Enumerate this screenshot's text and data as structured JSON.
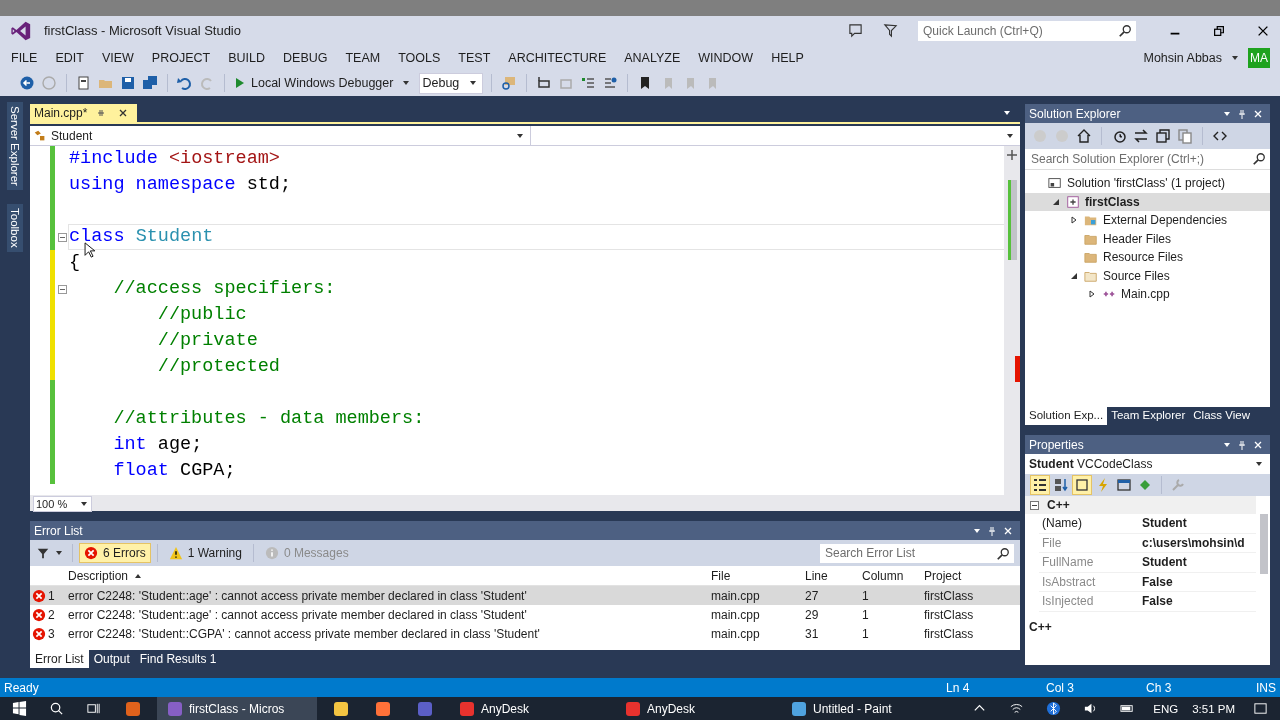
{
  "window": {
    "title": "firstClass - Microsoft Visual Studio",
    "quick_launch": {
      "placeholder": "Quick Launch (Ctrl+Q)"
    },
    "user": "Mohsin Abbas",
    "avatar": "MA"
  },
  "menu": [
    "FILE",
    "EDIT",
    "VIEW",
    "PROJECT",
    "BUILD",
    "DEBUG",
    "TEAM",
    "TOOLS",
    "TEST",
    "ARCHITECTURE",
    "ANALYZE",
    "WINDOW",
    "HELP"
  ],
  "toolbar": {
    "debugger": "Local Windows Debugger",
    "configuration": "Debug"
  },
  "side_tabs": [
    "Server Explorer",
    "Toolbox"
  ],
  "editor": {
    "tab": {
      "label": "Main.cpp*"
    },
    "scope": "Student",
    "zoom": "100 %",
    "lines": [
      {
        "modified": false,
        "tokens": [
          {
            "kind": "keyword",
            "text": "#include "
          },
          {
            "kind": "string",
            "text": "<iostream>"
          }
        ]
      },
      {
        "modified": false,
        "tokens": [
          {
            "kind": "keyword",
            "text": "using namespace "
          },
          {
            "kind": "plain",
            "text": "std;"
          }
        ]
      },
      {
        "modified": false
      },
      {
        "modified": false,
        "current": true,
        "foldable": true,
        "tokens": [
          {
            "kind": "keyword",
            "text": "class "
          },
          {
            "kind": "type",
            "text": "Student"
          }
        ]
      },
      {
        "modified": true,
        "tokens": [
          {
            "kind": "plain",
            "text": "{"
          }
        ]
      },
      {
        "modified": true,
        "foldable": true,
        "tokens": [
          {
            "kind": "comment",
            "text": "    //access specifiers:"
          }
        ]
      },
      {
        "modified": true,
        "tokens": [
          {
            "kind": "comment",
            "text": "        //public"
          }
        ]
      },
      {
        "modified": true,
        "tokens": [
          {
            "kind": "comment",
            "text": "        //private"
          }
        ]
      },
      {
        "modified": true,
        "tokens": [
          {
            "kind": "comment",
            "text": "        //protected"
          }
        ]
      },
      {
        "modified": false
      },
      {
        "modified": false,
        "tokens": [
          {
            "kind": "comment",
            "text": "    //attributes - data members:"
          }
        ]
      },
      {
        "modified": false,
        "tokens": [
          {
            "kind": "keyword",
            "text": "    int "
          },
          {
            "kind": "plain",
            "text": "age;"
          }
        ]
      },
      {
        "modified": false,
        "tokens": [
          {
            "kind": "keyword",
            "text": "    float "
          },
          {
            "kind": "plain",
            "text": "CGPA;"
          }
        ]
      }
    ]
  },
  "error_list": {
    "title": "Error List",
    "filters": [
      {
        "label": "6 Errors",
        "kind": "error",
        "selected": true
      },
      {
        "label": "1 Warning",
        "kind": "warning",
        "selected": false
      },
      {
        "label": "0 Messages",
        "kind": "message",
        "selected": false
      }
    ],
    "search": {
      "placeholder": "Search Error List"
    },
    "columns": [
      {
        "label": "Description",
        "sorted": true
      },
      {
        "label": "File",
        "sorted": false
      },
      {
        "label": "Line",
        "sorted": false
      },
      {
        "label": "Column",
        "sorted": false
      },
      {
        "label": "Project",
        "sorted": false
      }
    ],
    "rows": [
      {
        "index": "1",
        "description": "error C2248: 'Student::age' : cannot access private member declared in class 'Student'",
        "file": "main.cpp",
        "line": "27",
        "column": "1",
        "project": "firstClass",
        "selected": true
      },
      {
        "index": "2",
        "description": "error C2248: 'Student::age' : cannot access private member declared in class 'Student'",
        "file": "main.cpp",
        "line": "29",
        "column": "1",
        "project": "firstClass",
        "selected": false
      },
      {
        "index": "3",
        "description": "error C2248: 'Student::CGPA' : cannot access private member declared in class 'Student'",
        "file": "main.cpp",
        "line": "31",
        "column": "1",
        "project": "firstClass",
        "selected": false
      }
    ],
    "tabs": [
      {
        "label": "Error List",
        "selected": true
      },
      {
        "label": "Output",
        "selected": false
      },
      {
        "label": "Find Results 1",
        "selected": false
      }
    ]
  },
  "solution_explorer": {
    "title": "Solution Explorer",
    "search": {
      "placeholder": "Search Solution Explorer (Ctrl+;)"
    },
    "tree": [
      {
        "label": "Solution 'firstClass' (1 project)",
        "kind": "solution",
        "selected": false,
        "children": [
          {
            "label": "firstClass",
            "kind": "project",
            "selected": true,
            "expanded": true,
            "children": [
              {
                "label": "External Dependencies",
                "kind": "deps",
                "selected": false,
                "expanded": false
              },
              {
                "label": "Header Files",
                "kind": "folder",
                "selected": false
              },
              {
                "label": "Resource Files",
                "kind": "folder",
                "selected": false
              },
              {
                "label": "Source Files",
                "kind": "folder",
                "selected": false,
                "expanded": true,
                "children": [
                  {
                    "label": "Main.cpp",
                    "kind": "cpp",
                    "selected": false,
                    "expanded": false
                  }
                ]
              }
            ]
          }
        ]
      }
    ],
    "tabs": [
      {
        "label": "Solution Exp...",
        "selected": true
      },
      {
        "label": "Team Explorer",
        "selected": false
      },
      {
        "label": "Class View",
        "selected": false
      }
    ]
  },
  "properties": {
    "title": "Properties",
    "object": "Student",
    "type": "VCCodeClass",
    "category": "C++",
    "rows": [
      {
        "name": "(Name)",
        "value": "Student",
        "readonly": false
      },
      {
        "name": "File",
        "value": "c:\\users\\mohsin\\d",
        "readonly": true
      },
      {
        "name": "FullName",
        "value": "Student",
        "readonly": true
      },
      {
        "name": "IsAbstract",
        "value": "False",
        "readonly": true
      },
      {
        "name": "IsInjected",
        "value": "False",
        "readonly": true
      }
    ],
    "description": "C++"
  },
  "status_bar": {
    "text": "Ready",
    "line": "Ln 4",
    "column": "Col 3",
    "char": "Ch 3",
    "mode": "INS"
  },
  "taskbar": {
    "apps": [
      {
        "kind": "matlab",
        "selected": false
      },
      {
        "label": "firstClass - Micros",
        "kind": "vs",
        "selected": true
      },
      {
        "kind": "folder",
        "selected": false
      },
      {
        "kind": "firefox",
        "selected": false
      },
      {
        "kind": "teams",
        "selected": false
      },
      {
        "label": "AnyDesk",
        "kind": "anydesk",
        "selected": false
      },
      {
        "label": "AnyDesk",
        "kind": "anydesk",
        "selected": false
      },
      {
        "label": "Untitled - Paint",
        "kind": "paint",
        "selected": false
      }
    ],
    "language": "ENG",
    "time": "3:51 PM"
  }
}
